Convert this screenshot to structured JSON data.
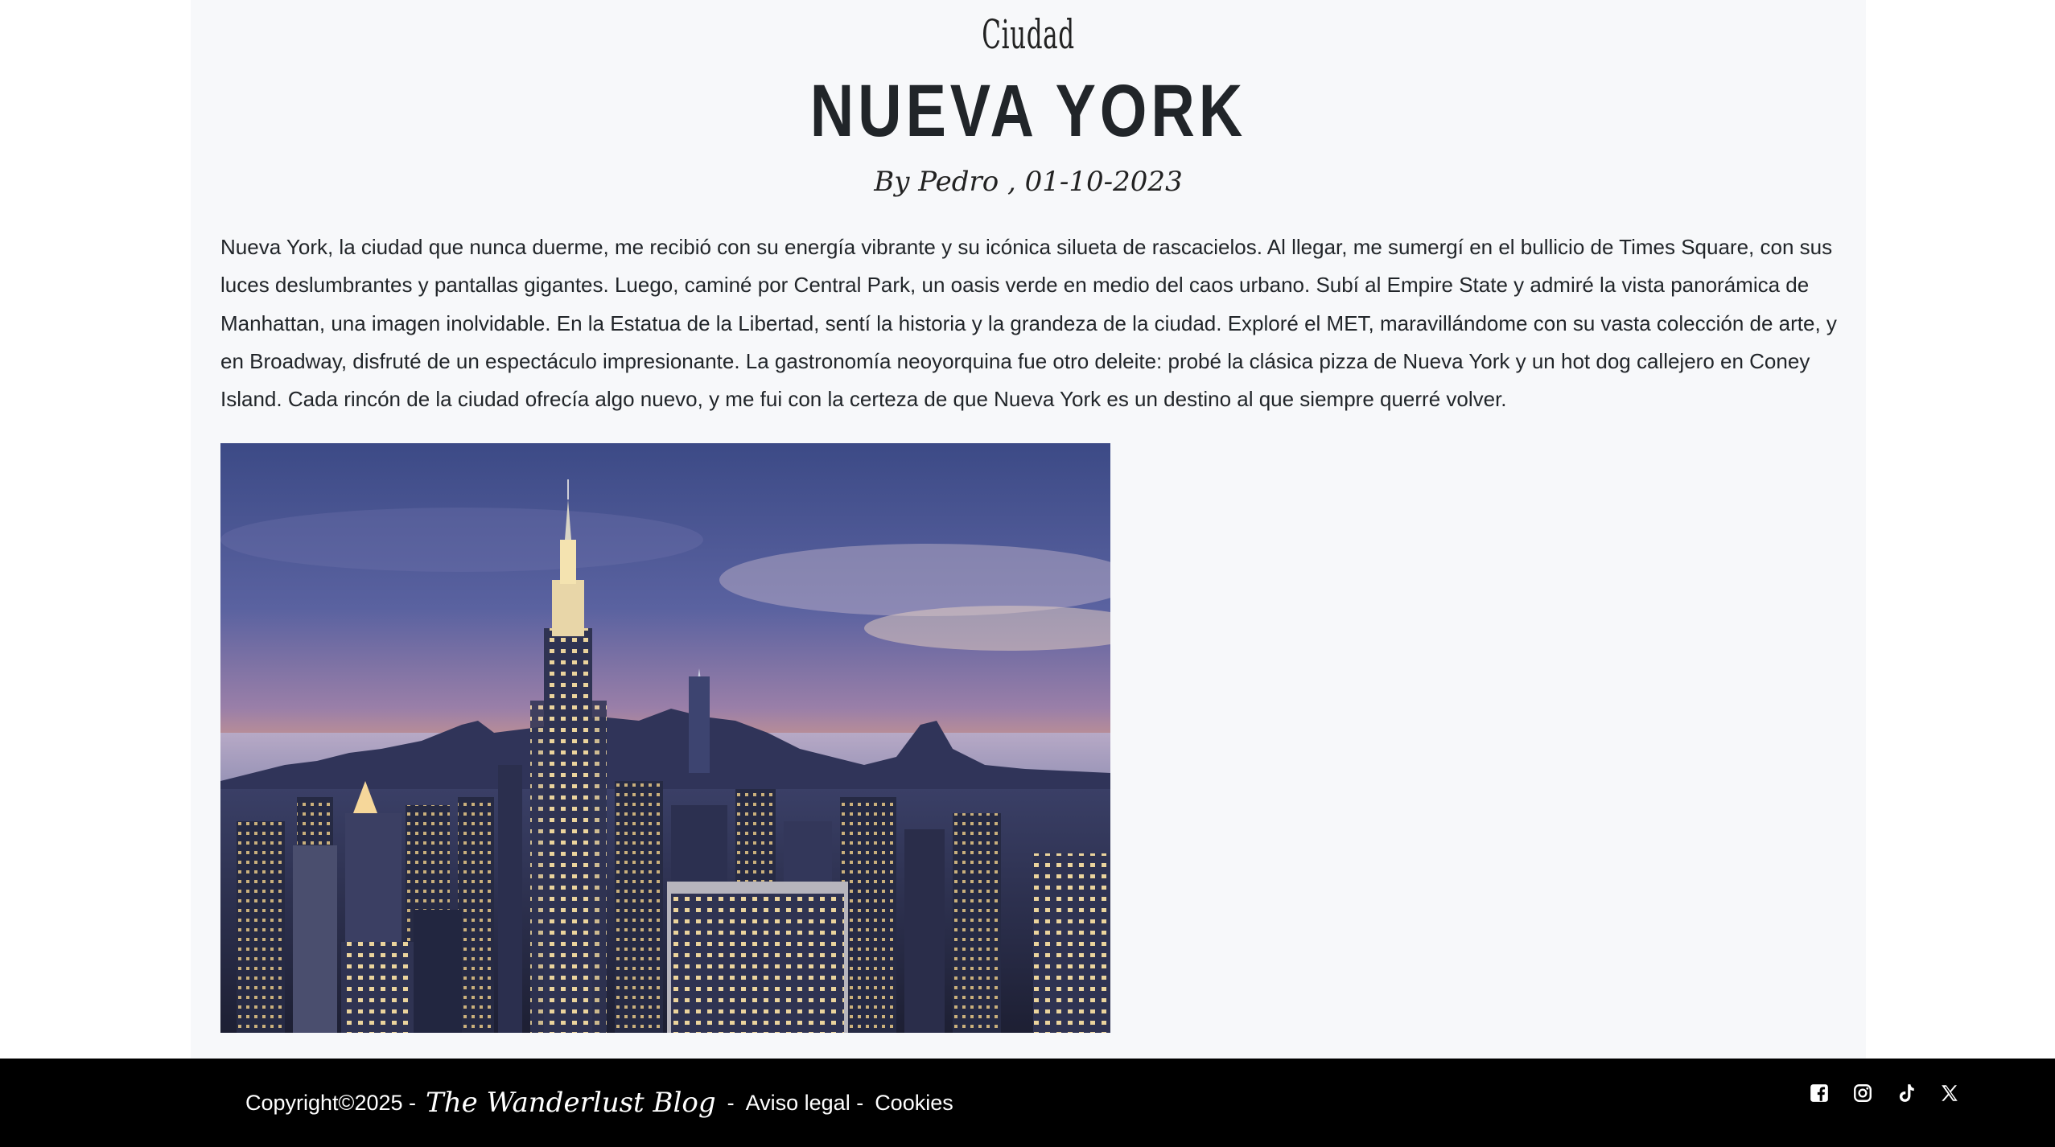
{
  "article": {
    "category": "Ciudad",
    "title": "NUEVA YORK",
    "byline": "By Pedro , 01-10-2023",
    "body": "Nueva York, la ciudad que nunca duerme, me recibió con su energía vibrante y su icónica silueta de rascacielos. Al llegar, me sumergí en el bullicio de Times Square, con sus luces deslumbrantes y pantallas gigantes. Luego, caminé por Central Park, un oasis verde en medio del caos urbano. Subí al Empire State y admiré la vista panorámica de Manhattan, una imagen inolvidable. En la Estatua de la Libertad, sentí la historia y la grandeza de la ciudad. Exploré el MET, maravillándome con su vasta colección de arte, y en Broadway, disfruté de un espectáculo impresionante. La gastronomía neoyorquina fue otro deleite: probé la clásica pizza de Nueva York y un hot dog callejero en Coney Island. Cada rincón de la ciudad ofrecía algo nuevo, y me fui con la certeza de que Nueva York es un destino al que siempre querré volver."
  },
  "footer": {
    "copyright": "Copyright©2025 -",
    "brand": "The Wanderlust Blog",
    "sep1": "-",
    "legal": "Aviso legal -",
    "cookies": "Cookies",
    "social_icons": [
      "facebook-icon",
      "instagram-icon",
      "tiktok-icon",
      "x-icon"
    ]
  },
  "colors": {
    "page_bg": "#ffffff",
    "content_bg": "#f7f8fa",
    "text": "#212529",
    "footer_bg": "#000000",
    "footer_text": "#ffffff"
  }
}
